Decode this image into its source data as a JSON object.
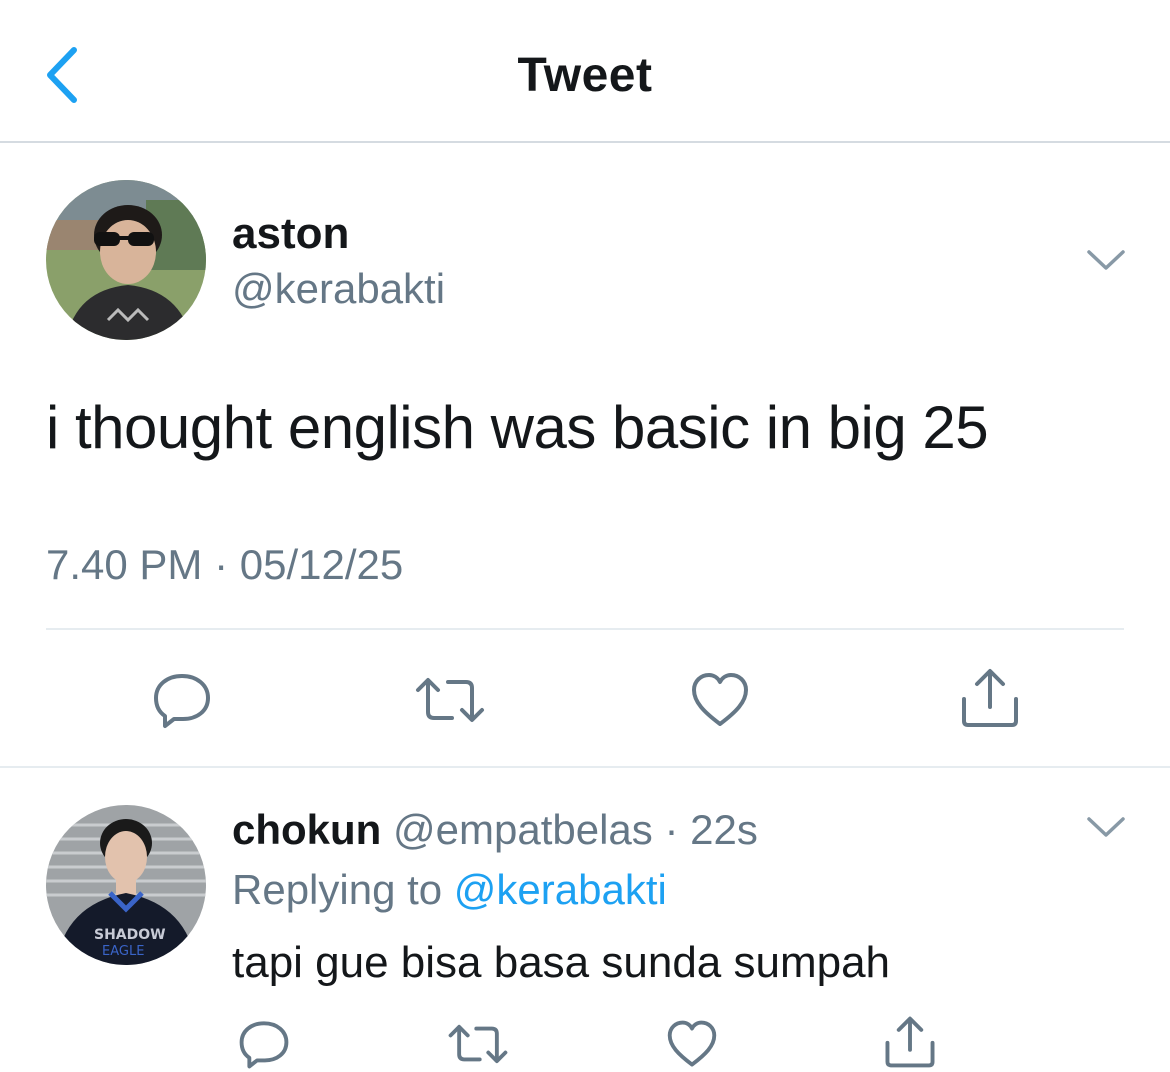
{
  "header": {
    "title": "Tweet",
    "back_icon": "chevron-left-icon"
  },
  "tweet": {
    "display_name": "aston",
    "handle": "@kerabakti",
    "text": "i thought english was basic in big 25",
    "timestamp": "7.40 PM · 05/12/25",
    "actions": [
      "reply-icon",
      "retweet-icon",
      "like-icon",
      "share-icon"
    ]
  },
  "reply": {
    "display_name": "chokun",
    "handle": "@empatbelas",
    "separator": " · ",
    "age": "22s",
    "replying_prefix": "Replying to ",
    "replying_to": "@kerabakti",
    "text": "tapi gue bisa basa sunda sumpah",
    "actions": [
      "reply-icon",
      "retweet-icon",
      "like-icon",
      "share-icon"
    ]
  },
  "colors": {
    "accent": "#1da1f2",
    "secondary_text": "#657786",
    "icon": "#657786",
    "divider": "#e6ecf0"
  }
}
